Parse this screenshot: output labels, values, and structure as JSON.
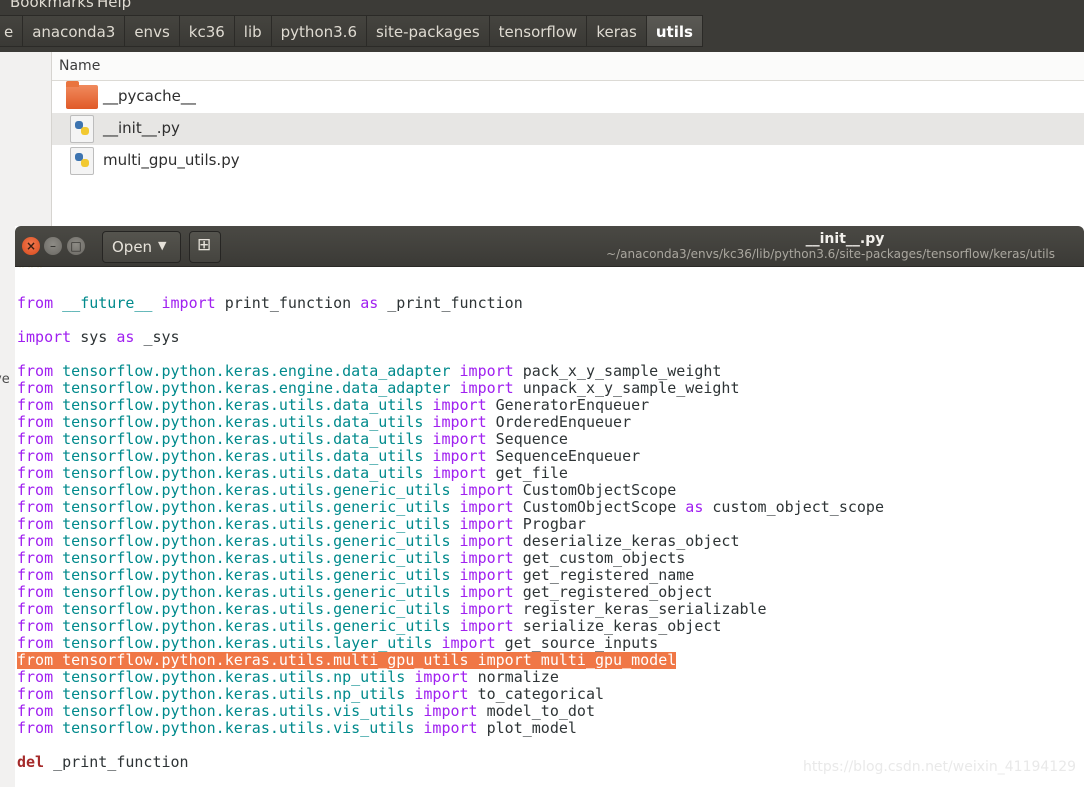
{
  "menubar": {
    "items": [
      "Bookmarks",
      "Help"
    ]
  },
  "pathbar": {
    "crumbs": [
      "e",
      "anaconda3",
      "envs",
      "kc36",
      "lib",
      "python3.6",
      "site-packages",
      "tensorflow",
      "keras",
      "utils"
    ]
  },
  "file_manager": {
    "column_header": "Name",
    "sidebar_fragment": "ve",
    "files": [
      {
        "name": "__pycache__",
        "icon": "folder-icon"
      },
      {
        "name": "__init__.py",
        "icon": "python-file-icon"
      },
      {
        "name": "multi_gpu_utils.py",
        "icon": "python-file-icon"
      }
    ]
  },
  "editor": {
    "open_label": "Open",
    "title": "__init__.py",
    "subtitle": "~/anaconda3/envs/kc36/lib/python3.6/site-packages/tensorflow/keras/utils",
    "lines": [
      {
        "y": 0,
        "text": "\"\"\"",
        "kind": "partial"
      },
      {
        "y": 1,
        "text": ""
      },
      {
        "y": 2,
        "kind": "future",
        "t1": "from",
        "t2": "__future__",
        "t3": "import",
        "t4": "print_function",
        "t5": "as",
        "t6": "_print_function"
      },
      {
        "y": 3,
        "text": ""
      },
      {
        "y": 4,
        "kind": "importsys",
        "t1": "import",
        "t2": "sys",
        "t3": "as",
        "t4": "_sys"
      },
      {
        "y": 5,
        "text": ""
      },
      {
        "y": 6,
        "kind": "fi",
        "mod": "tensorflow.python.keras.engine.data_adapter",
        "name": "pack_x_y_sample_weight"
      },
      {
        "y": 7,
        "kind": "fi",
        "mod": "tensorflow.python.keras.engine.data_adapter",
        "name": "unpack_x_y_sample_weight"
      },
      {
        "y": 8,
        "kind": "fi",
        "mod": "tensorflow.python.keras.utils.data_utils",
        "name": "GeneratorEnqueuer"
      },
      {
        "y": 9,
        "kind": "fi",
        "mod": "tensorflow.python.keras.utils.data_utils",
        "name": "OrderedEnqueuer"
      },
      {
        "y": 10,
        "kind": "fi",
        "mod": "tensorflow.python.keras.utils.data_utils",
        "name": "Sequence"
      },
      {
        "y": 11,
        "kind": "fi",
        "mod": "tensorflow.python.keras.utils.data_utils",
        "name": "SequenceEnqueuer"
      },
      {
        "y": 12,
        "kind": "fi",
        "mod": "tensorflow.python.keras.utils.data_utils",
        "name": "get_file"
      },
      {
        "y": 13,
        "kind": "fi",
        "mod": "tensorflow.python.keras.utils.generic_utils",
        "name": "CustomObjectScope"
      },
      {
        "y": 14,
        "kind": "fias",
        "mod": "tensorflow.python.keras.utils.generic_utils",
        "name": "CustomObjectScope",
        "as": "as",
        "alias": "custom_object_scope"
      },
      {
        "y": 15,
        "kind": "fi",
        "mod": "tensorflow.python.keras.utils.generic_utils",
        "name": "Progbar"
      },
      {
        "y": 16,
        "kind": "fi",
        "mod": "tensorflow.python.keras.utils.generic_utils",
        "name": "deserialize_keras_object"
      },
      {
        "y": 17,
        "kind": "fi",
        "mod": "tensorflow.python.keras.utils.generic_utils",
        "name": "get_custom_objects"
      },
      {
        "y": 18,
        "kind": "fi",
        "mod": "tensorflow.python.keras.utils.generic_utils",
        "name": "get_registered_name"
      },
      {
        "y": 19,
        "kind": "fi",
        "mod": "tensorflow.python.keras.utils.generic_utils",
        "name": "get_registered_object"
      },
      {
        "y": 20,
        "kind": "fi",
        "mod": "tensorflow.python.keras.utils.generic_utils",
        "name": "register_keras_serializable"
      },
      {
        "y": 21,
        "kind": "fi",
        "mod": "tensorflow.python.keras.utils.generic_utils",
        "name": "serialize_keras_object"
      },
      {
        "y": 22,
        "kind": "fi",
        "mod": "tensorflow.python.keras.utils.layer_utils",
        "name": "get_source_inputs"
      },
      {
        "y": 23,
        "kind": "fi",
        "mod": "tensorflow.python.keras.utils.multi_gpu_utils",
        "name": "multi_gpu_model",
        "highlight": true
      },
      {
        "y": 24,
        "kind": "fi",
        "mod": "tensorflow.python.keras.utils.np_utils",
        "name": "normalize"
      },
      {
        "y": 25,
        "kind": "fi",
        "mod": "tensorflow.python.keras.utils.np_utils",
        "name": "to_categorical"
      },
      {
        "y": 26,
        "kind": "fi",
        "mod": "tensorflow.python.keras.utils.vis_utils",
        "name": "model_to_dot"
      },
      {
        "y": 27,
        "kind": "fi",
        "mod": "tensorflow.python.keras.utils.vis_utils",
        "name": "plot_model"
      },
      {
        "y": 28,
        "text": ""
      },
      {
        "y": 29,
        "kind": "del",
        "t1": "del",
        "t2": "_print_function"
      }
    ],
    "kw_from": "from",
    "kw_import": "import"
  },
  "watermark": "https://blog.csdn.net/weixin_41194129",
  "colors": {
    "keyword": "#a020f0",
    "module": "#008a8c",
    "highlight": "#f07746",
    "del": "#a52a2a"
  }
}
